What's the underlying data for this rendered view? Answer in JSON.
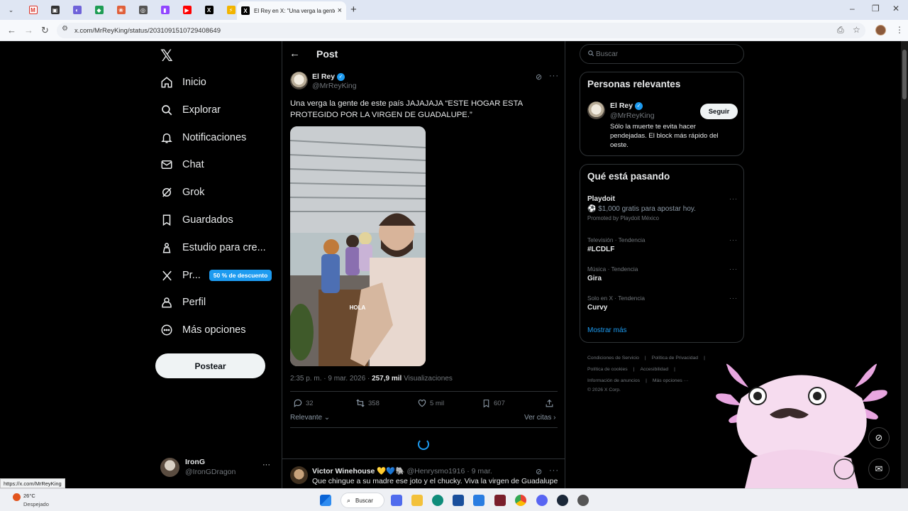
{
  "browser": {
    "tab_title": "El Rey en X: \"Una verga la gente",
    "url": "x.com/MrReyKing/status/2031091510729408649",
    "status_url": "https://x.com/MrReyKing"
  },
  "sidebar": {
    "items": [
      {
        "label": "Inicio",
        "icon": "home-icon"
      },
      {
        "label": "Explorar",
        "icon": "search-icon"
      },
      {
        "label": "Notificaciones",
        "icon": "bell-icon"
      },
      {
        "label": "Chat",
        "icon": "mail-icon"
      },
      {
        "label": "Grok",
        "icon": "grok-icon"
      },
      {
        "label": "Guardados",
        "icon": "bookmark-icon"
      },
      {
        "label": "Estudio para cre...",
        "icon": "creator-studio-icon"
      },
      {
        "label": "Pr...",
        "icon": "x-premium-icon"
      },
      {
        "label": "Perfil",
        "icon": "user-icon"
      },
      {
        "label": "Más opciones",
        "icon": "more-circle-icon"
      }
    ],
    "premium_badge": "50 % de descuento",
    "post_button": "Postear",
    "account": {
      "name": "IronG",
      "handle": "@IronGDragon"
    }
  },
  "main": {
    "title": "Post",
    "tweet": {
      "author": "El Rey",
      "handle": "@MrReyKing",
      "text": "Una verga la gente de este país JAJAJAJA “ESTE HOGAR ESTA PROTEGIDO POR LA VIRGEN DE GUADALUPE.”",
      "video_caption": "HOLA",
      "time": "2:35 p. m. · 9 mar. 2026 · ",
      "views_count": "257,9 mil",
      "views_label": " Visualizaciones",
      "replies": "32",
      "reposts": "358",
      "likes": "5 mil",
      "bookmarks": "607"
    },
    "sort_label": "Relevante",
    "quotes_label": "Ver citas",
    "reply": {
      "author": "Victor Winehouse 💛💙🐘",
      "handle_time": "@Henrysmo1916 · 9 mar.",
      "text": "Que chingue a su madre ese joto y el chucky. Viva la virgen de Guadalupe"
    }
  },
  "right": {
    "search_placeholder": "Buscar",
    "relevant": {
      "title": "Personas relevantes",
      "name": "El Rey",
      "handle": "@MrReyKing",
      "follow": "Seguir",
      "bio": "Sólo la muerte te evita hacer pendejadas. El block más rápido del oeste."
    },
    "trending": {
      "title": "Qué está pasando",
      "promo": {
        "name": "Playdoit",
        "sub": "⚽ $1,000 gratis para apostar hoy.",
        "promoted": "Promoted by Playdoit México"
      },
      "items": [
        {
          "category": "Televisión · Tendencia",
          "name": "#LCDLF"
        },
        {
          "category": "Música · Tendencia",
          "name": "Gira"
        },
        {
          "category": "Solo en X · Tendencia",
          "name": "Curvy"
        }
      ],
      "show_more": "Mostrar más"
    },
    "footer": {
      "line1": [
        "Condiciones de Servicio",
        "Política de Privacidad"
      ],
      "line2": [
        "Política de cookies",
        "Accesibilidad"
      ],
      "line3": [
        "Información de anuncios",
        "Más opciones ···"
      ],
      "copyright": "© 2026 X Corp."
    }
  },
  "taskbar": {
    "temp": "26°C",
    "weather": "Despejado",
    "search": "Buscar"
  },
  "colors": {
    "accent": "#1d9bf0",
    "background": "#000000",
    "border": "#2f3336"
  }
}
